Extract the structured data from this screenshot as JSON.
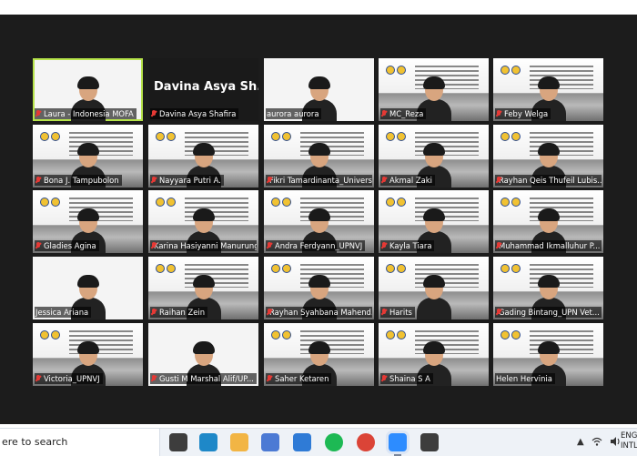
{
  "participants": [
    {
      "name": "Laura - Indonesia MOFA",
      "muted": true,
      "active": true,
      "kind": "cam"
    },
    {
      "name": "Davina Asya Shafira",
      "muted": true,
      "active": false,
      "kind": "namecard",
      "display": "Davina Asya Sh..."
    },
    {
      "name": "aurora aurora",
      "muted": false,
      "active": false,
      "kind": "cam"
    },
    {
      "name": "MC_Reza",
      "muted": true,
      "active": false,
      "kind": "slide"
    },
    {
      "name": "Feby Welga",
      "muted": true,
      "active": false,
      "kind": "slide"
    },
    {
      "name": "Bona J. Tampubolon",
      "muted": true,
      "active": false,
      "kind": "slide"
    },
    {
      "name": "Nayyara Putri A.",
      "muted": true,
      "active": false,
      "kind": "slide"
    },
    {
      "name": "Fikri Tamardinanta_Univers...",
      "muted": true,
      "active": false,
      "kind": "slide"
    },
    {
      "name": "Akmal Zaki",
      "muted": true,
      "active": false,
      "kind": "slide"
    },
    {
      "name": "Rayhan Qeis Thufeil Lubis...",
      "muted": true,
      "active": false,
      "kind": "slide"
    },
    {
      "name": "Gladies Agina",
      "muted": true,
      "active": false,
      "kind": "slide"
    },
    {
      "name": "Karina Hasiyanni Manurung",
      "muted": true,
      "active": false,
      "kind": "slide"
    },
    {
      "name": "Andra Ferdyann_UPNVJ",
      "muted": true,
      "active": false,
      "kind": "slide"
    },
    {
      "name": "Kayla Tiara",
      "muted": true,
      "active": false,
      "kind": "slide"
    },
    {
      "name": "Muhammad Ikmalluhur P...",
      "muted": true,
      "active": false,
      "kind": "slide"
    },
    {
      "name": "Jessica Ariana",
      "muted": false,
      "active": false,
      "kind": "cam"
    },
    {
      "name": "Raihan Zein",
      "muted": true,
      "active": false,
      "kind": "slide"
    },
    {
      "name": "Rayhan Syahbana Mahend...",
      "muted": true,
      "active": false,
      "kind": "slide"
    },
    {
      "name": "Harits",
      "muted": true,
      "active": false,
      "kind": "slide"
    },
    {
      "name": "Gading Bintang_UPN Vet...",
      "muted": true,
      "active": false,
      "kind": "slide"
    },
    {
      "name": "Victoria_UPNVJ",
      "muted": true,
      "active": false,
      "kind": "slide"
    },
    {
      "name": "Gusti M Marshal Alif/UP...",
      "muted": true,
      "active": false,
      "kind": "cam"
    },
    {
      "name": "Saher Ketaren",
      "muted": true,
      "active": false,
      "kind": "slide"
    },
    {
      "name": "Shaina S A",
      "muted": true,
      "active": false,
      "kind": "slide"
    },
    {
      "name": "Helen Hervinia",
      "muted": false,
      "active": false,
      "kind": "slide"
    }
  ],
  "taskbar": {
    "search_text": "ere to search",
    "apps": [
      "task-view-icon",
      "edge-browser-icon",
      "file-explorer-icon",
      "store-icon",
      "mail-icon",
      "spotify-icon",
      "chrome-icon",
      "zoom-icon",
      "settings-gear-icon"
    ],
    "tray_lang": "ENG",
    "tray_lang2": "INTL"
  },
  "colors": {
    "stage_bg": "#1c1c1c",
    "active_outline": "#b6e34a",
    "muted_icon": "#e53935"
  }
}
